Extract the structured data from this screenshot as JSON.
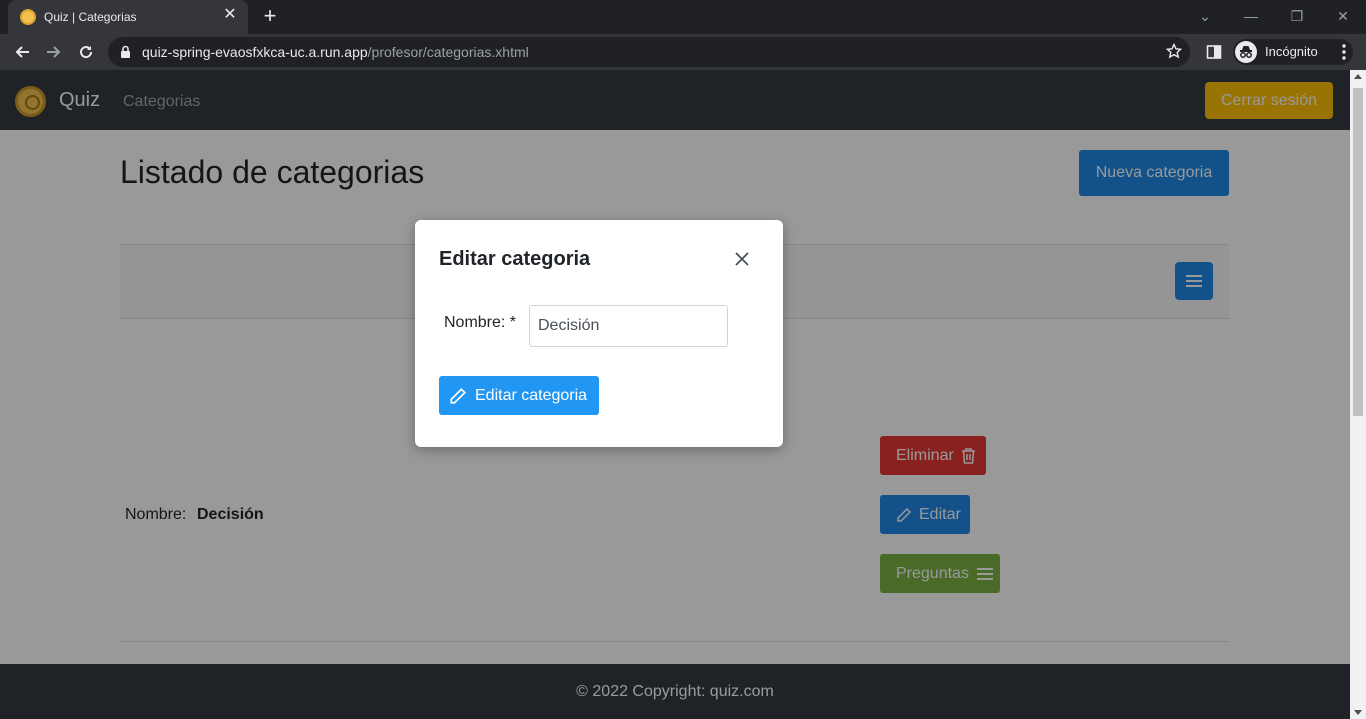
{
  "browser": {
    "tab_title": "Quiz | Categorias",
    "url_host": "quiz-spring-evaosfxkca-uc.a.run.app",
    "url_path": "/profesor/categorias.xhtml",
    "profile_label": "Incógnito"
  },
  "navbar": {
    "brand": "Quiz",
    "nav_link": "Categorias",
    "logout_label": "Cerrar sesión"
  },
  "page": {
    "title": "Listado de categorias",
    "new_button": "Nueva categoria"
  },
  "category_row": {
    "label": "Nombre:",
    "value": "Decisión",
    "delete_label": "Eliminar",
    "edit_label": "Editar",
    "questions_label": "Preguntas"
  },
  "modal": {
    "title": "Editar categoria",
    "field_label": "Nombre: *",
    "field_value": "Decisión",
    "submit_label": "Editar categoria"
  },
  "footer": {
    "text": "© 2022 Copyright: quiz.com"
  },
  "colors": {
    "navbar": "#343a40",
    "primary": "#1e88e5",
    "danger": "#e53935",
    "success": "#7cb342",
    "warning": "#ffc107"
  }
}
